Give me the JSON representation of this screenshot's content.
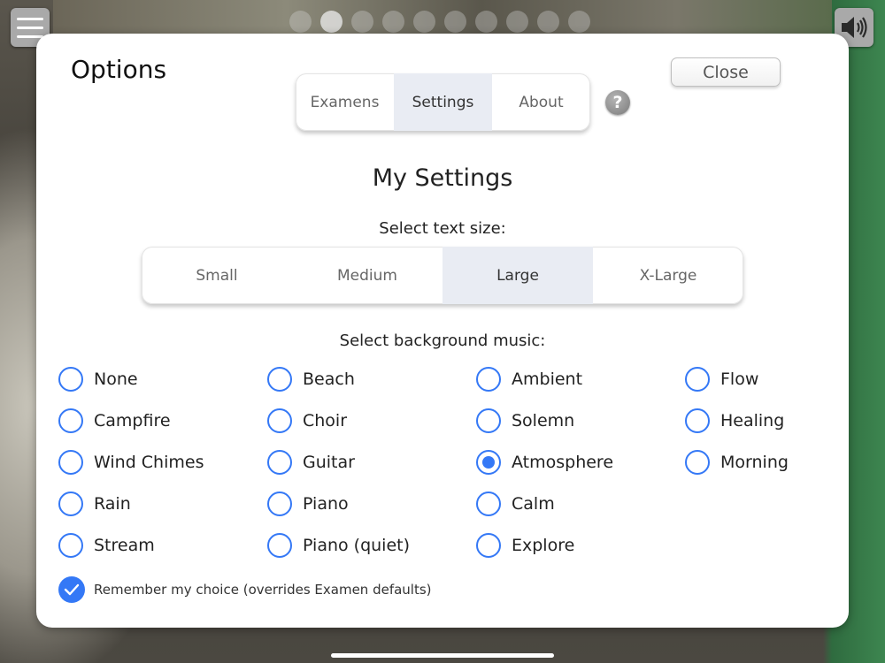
{
  "topbar": {
    "page_dots": 10,
    "active_dot": 1
  },
  "panel": {
    "title": "Options",
    "close_label": "Close",
    "tabs": [
      {
        "label": "Examens",
        "selected": false
      },
      {
        "label": "Settings",
        "selected": true
      },
      {
        "label": "About",
        "selected": false
      }
    ],
    "help_label": "?"
  },
  "settings": {
    "heading": "My Settings",
    "text_size_label": "Select text size:",
    "text_sizes": [
      {
        "label": "Small",
        "selected": false
      },
      {
        "label": "Medium",
        "selected": false
      },
      {
        "label": "Large",
        "selected": true
      },
      {
        "label": "X-Large",
        "selected": false
      }
    ],
    "music_label": "Select background music:",
    "music_columns": [
      [
        "None",
        "Campfire",
        "Wind Chimes",
        "Rain",
        "Stream"
      ],
      [
        "Beach",
        "Choir",
        "Guitar",
        "Piano",
        "Piano (quiet)"
      ],
      [
        "Ambient",
        "Solemn",
        "Atmosphere",
        "Calm",
        "Explore"
      ],
      [
        "Flow",
        "Healing",
        "Morning"
      ]
    ],
    "selected_music": "Atmosphere",
    "remember_label": "Remember my choice (overrides Examen defaults)",
    "remember_checked": true
  },
  "colors": {
    "accent": "#3478f6",
    "segment_selected": "#e9ecf3"
  }
}
